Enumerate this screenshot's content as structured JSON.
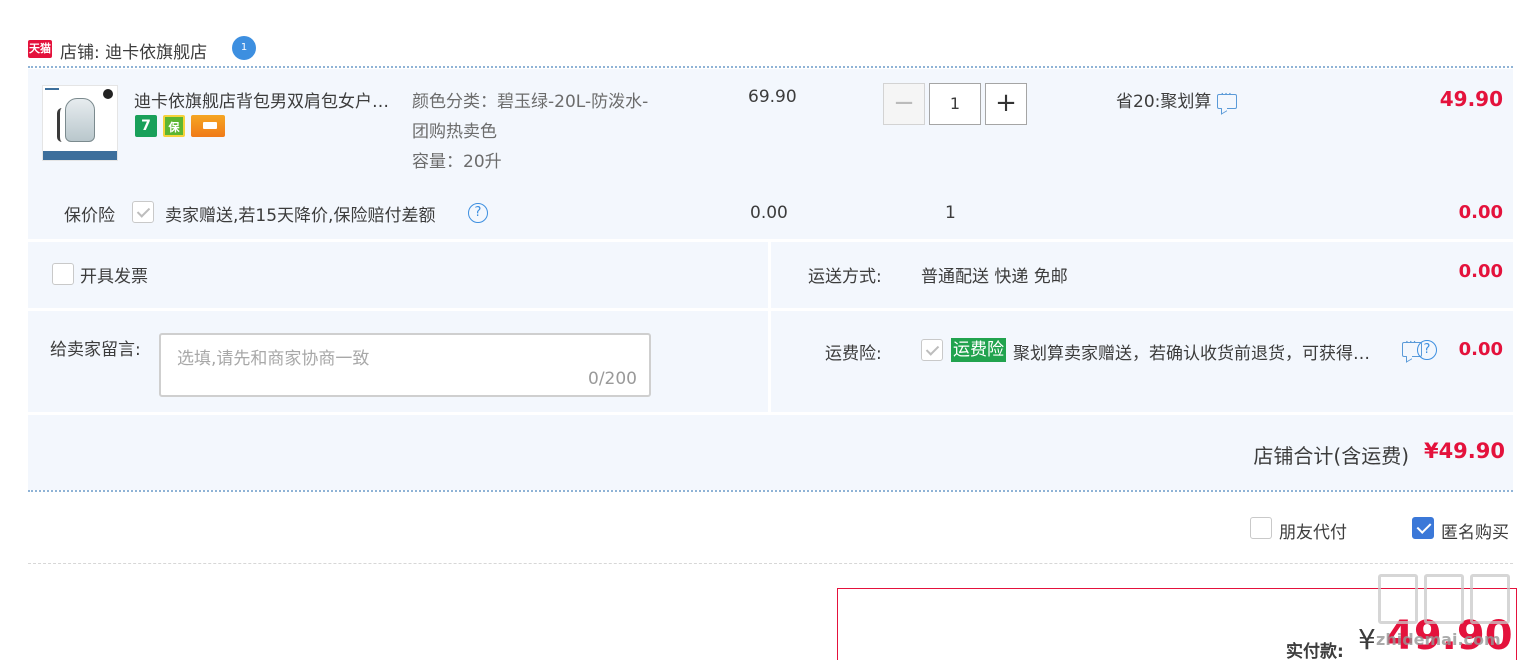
{
  "shop": {
    "badge": "天猫",
    "name": "店铺: 迪卡依旗舰店",
    "chat_count": "1"
  },
  "item": {
    "title": "迪卡依旗舰店背包男双肩包女户外登山包",
    "service_icons": [
      "7-day-return-icon",
      "consumer-guarantee-icon",
      "credit-card-icon"
    ],
    "seven_label": "7",
    "guard_label": "保",
    "sku_color": "颜色分类：碧玉绿-20L-防泼水-",
    "sku_color_2": "团购热卖色",
    "sku_capacity": "容量：20升",
    "unit_price": "69.90",
    "minus_label": "−",
    "quantity": "1",
    "plus_label": "+",
    "promo": "省20:聚划算",
    "total": "49.90"
  },
  "insurance": {
    "label": "保价险",
    "checked": true,
    "text": "卖家赠送,若15天降价,保险赔付差额",
    "help_label": "?",
    "price": "0.00",
    "qty": "1",
    "total": "0.00"
  },
  "invoice": {
    "label": "开具发票",
    "checked": false
  },
  "shipping": {
    "label": "运送方式:",
    "value": "普通配送 快递 免邮",
    "fee": "0.00"
  },
  "message": {
    "label": "给卖家留言:",
    "placeholder": "选填,请先和商家协商一致",
    "count": "0/200"
  },
  "freight_insurance": {
    "label": "运费险:",
    "checked": true,
    "badge": "运费险",
    "text": "聚划算卖家赠送，若确认收货前退货，可获得运费补偿",
    "help_label": "?",
    "fee": "0.00"
  },
  "summary": {
    "label": "店铺合计(含运费)",
    "value": "¥49.90"
  },
  "options": {
    "friend_pay_label": "朋友代付",
    "friend_pay_checked": false,
    "anonymous_label": "匿名购买",
    "anonymous_checked": true
  },
  "payment": {
    "label": "实付款:",
    "currency": "¥",
    "amount": "49.90"
  },
  "watermark": {
    "text": "zhidemai.com"
  },
  "colors": {
    "accent_red": "#e4123c",
    "panel_bg": "#f3f7fd",
    "checkbox_blue": "#3b78d8",
    "badge_green": "#21a34e"
  }
}
